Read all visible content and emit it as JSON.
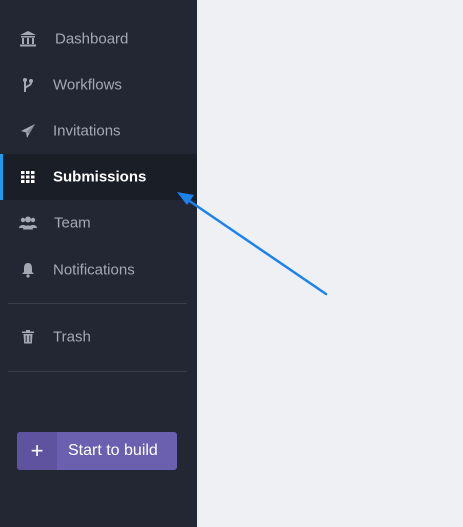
{
  "sidebar": {
    "items": [
      {
        "label": "Dashboard",
        "icon": "bank-icon"
      },
      {
        "label": "Workflows",
        "icon": "branch-icon"
      },
      {
        "label": "Invitations",
        "icon": "paper-plane-icon"
      },
      {
        "label": "Submissions",
        "icon": "grid-icon",
        "active": true
      },
      {
        "label": "Team",
        "icon": "users-icon"
      },
      {
        "label": "Notifications",
        "icon": "bell-icon"
      },
      {
        "label": "Trash",
        "icon": "trash-icon"
      }
    ],
    "build_button": {
      "plus": "+",
      "label": "Start to build"
    }
  },
  "colors": {
    "sidebar_bg": "#232733",
    "active_bg": "#1a1e27",
    "active_indicator": "#1f9cf0",
    "text_muted": "#a3a8b3",
    "main_bg": "#eff0f4",
    "button_bg": "#6b5fb0",
    "annotation_arrow": "#1a83f0"
  }
}
